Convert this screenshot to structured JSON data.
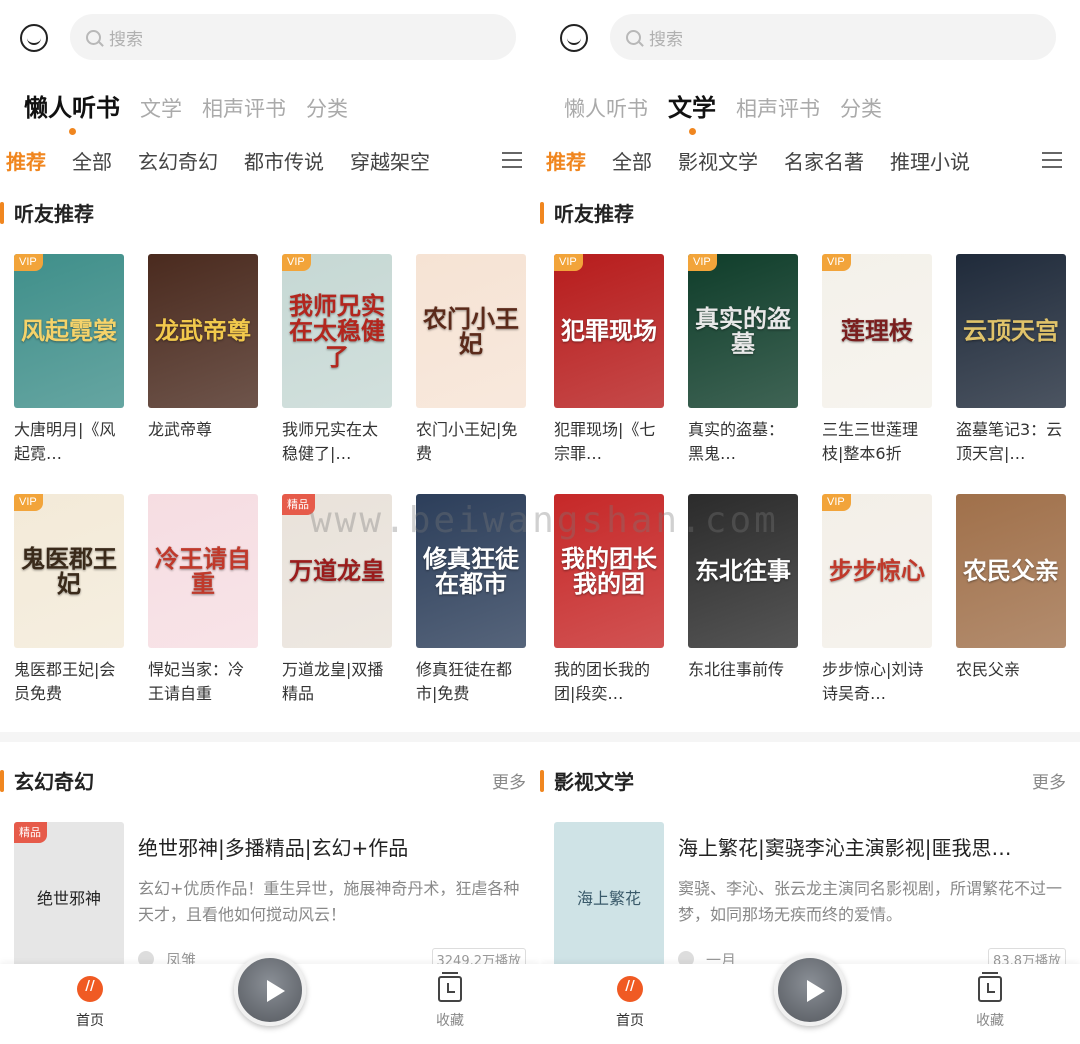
{
  "screens": [
    {
      "search_placeholder": "搜索",
      "tabs_main": [
        {
          "label": "懒人听书",
          "active": true
        },
        {
          "label": "文学",
          "active": false
        },
        {
          "label": "相声评书",
          "active": false
        },
        {
          "label": "分类",
          "active": false
        }
      ],
      "tabs_sub": [
        {
          "label": "推荐",
          "active": true
        },
        {
          "label": "全部",
          "active": false
        },
        {
          "label": "玄幻奇幻",
          "active": false
        },
        {
          "label": "都市传说",
          "active": false
        },
        {
          "label": "穿越架空",
          "active": false
        }
      ],
      "section1_title": "听友推荐",
      "books": [
        {
          "badge": "VIP",
          "cover_text": "风起霓裳",
          "title": "大唐明月|《风起霓…",
          "bg": "#3f8f8a",
          "fg": "#f5d36a"
        },
        {
          "badge": "",
          "cover_text": "龙武帝尊",
          "title": "龙武帝尊",
          "bg": "#4a2a1e",
          "fg": "#f2c94c"
        },
        {
          "badge": "VIP",
          "cover_text": "我师兄实在太稳健了",
          "title": "我师兄实在太稳健了|…",
          "bg": "#c6d8d4",
          "fg": "#b3261e"
        },
        {
          "badge": "",
          "cover_text": "农门小王妃",
          "title": "农门小王妃|免费",
          "bg": "#f6e3d4",
          "fg": "#5b2a1a"
        },
        {
          "badge": "VIP",
          "cover_text": "鬼医郡王妃",
          "title": "鬼医郡王妃|会员免费",
          "bg": "#f3ead8",
          "fg": "#3a2a1a"
        },
        {
          "badge": "",
          "cover_text": "冷王请自重",
          "title": "悍妃当家：冷王请自重",
          "bg": "#f6dde2",
          "fg": "#c0392b"
        },
        {
          "badge": "精品",
          "cover_text": "万道龙皇",
          "title": "万道龙皇|双播精品",
          "bg": "#e9e2da",
          "fg": "#9a1c1c"
        },
        {
          "badge": "",
          "cover_text": "修真狂徒在都市",
          "title": "修真狂徒在都市|免费",
          "bg": "#2c3e5a",
          "fg": "#ffffff"
        }
      ],
      "section2_title": "玄幻奇幻",
      "more_label": "更多",
      "feature": {
        "badge": "精品",
        "cover_text": "绝世邪神",
        "title": "绝世邪神|多播精品|玄幻+作品",
        "desc": "玄幻+优质作品！重生异世，施展神奇丹术，狂虐各种天才，且看他如何搅动风云！",
        "author": "凤雏",
        "plays": "3249.2万播放",
        "bg": "#e6e6e6",
        "fg": "#222222"
      }
    },
    {
      "search_placeholder": "搜索",
      "tabs_main": [
        {
          "label": "懒人听书",
          "active": false
        },
        {
          "label": "文学",
          "active": true
        },
        {
          "label": "相声评书",
          "active": false
        },
        {
          "label": "分类",
          "active": false
        }
      ],
      "tabs_sub": [
        {
          "label": "推荐",
          "active": true
        },
        {
          "label": "全部",
          "active": false
        },
        {
          "label": "影视文学",
          "active": false
        },
        {
          "label": "名家名著",
          "active": false
        },
        {
          "label": "推理小说",
          "active": false
        }
      ],
      "section1_title": "听友推荐",
      "books": [
        {
          "badge": "VIP",
          "cover_text": "犯罪现场",
          "title": "犯罪现场|《七宗罪…",
          "bg": "#b71c1c",
          "fg": "#ffffff"
        },
        {
          "badge": "VIP",
          "cover_text": "真实的盗墓",
          "title": "真实的盗墓：黑鬼…",
          "bg": "#0f3d2a",
          "fg": "#e8e8e8"
        },
        {
          "badge": "VIP",
          "cover_text": "莲理枝",
          "title": "三生三世莲理枝|整本6折",
          "bg": "#f4f1ea",
          "fg": "#7a1e1e"
        },
        {
          "badge": "",
          "cover_text": "云顶天宫",
          "title": "盗墓笔记3：云顶天宫|…",
          "bg": "#1f2a3a",
          "fg": "#e0c36a"
        },
        {
          "badge": "",
          "cover_text": "我的团长我的团",
          "title": "我的团长我的团|段奕…",
          "bg": "#c62828",
          "fg": "#ffffff"
        },
        {
          "badge": "",
          "cover_text": "东北往事",
          "title": "东北往事前传",
          "bg": "#2b2b2b",
          "fg": "#ffffff"
        },
        {
          "badge": "VIP",
          "cover_text": "步步惊心",
          "title": "步步惊心|刘诗诗吴奇…",
          "bg": "#f3efe8",
          "fg": "#c0392b"
        },
        {
          "badge": "",
          "cover_text": "农民父亲",
          "title": "农民父亲",
          "bg": "#a0704a",
          "fg": "#ffffff"
        }
      ],
      "section2_title": "影视文学",
      "more_label": "更多",
      "feature": {
        "badge": "",
        "cover_text": "海上繁花",
        "title": "海上繁花|窦骁李沁主演影视|匪我思…",
        "desc": "窦骁、李沁、张云龙主演同名影视剧，所谓繁花不过一梦，如同那场无疾而终的爱情。",
        "author": "一月",
        "plays": "83.8万播放",
        "bg": "#cfe3e6",
        "fg": "#3a5a6a"
      }
    }
  ],
  "bottom_nav": {
    "home": "首页",
    "favorites": "收藏"
  },
  "watermark": "www.beiwangshan.com",
  "colors": {
    "accent": "#f0861f",
    "vip": "#f2a43a",
    "premium": "#e65b4a"
  }
}
